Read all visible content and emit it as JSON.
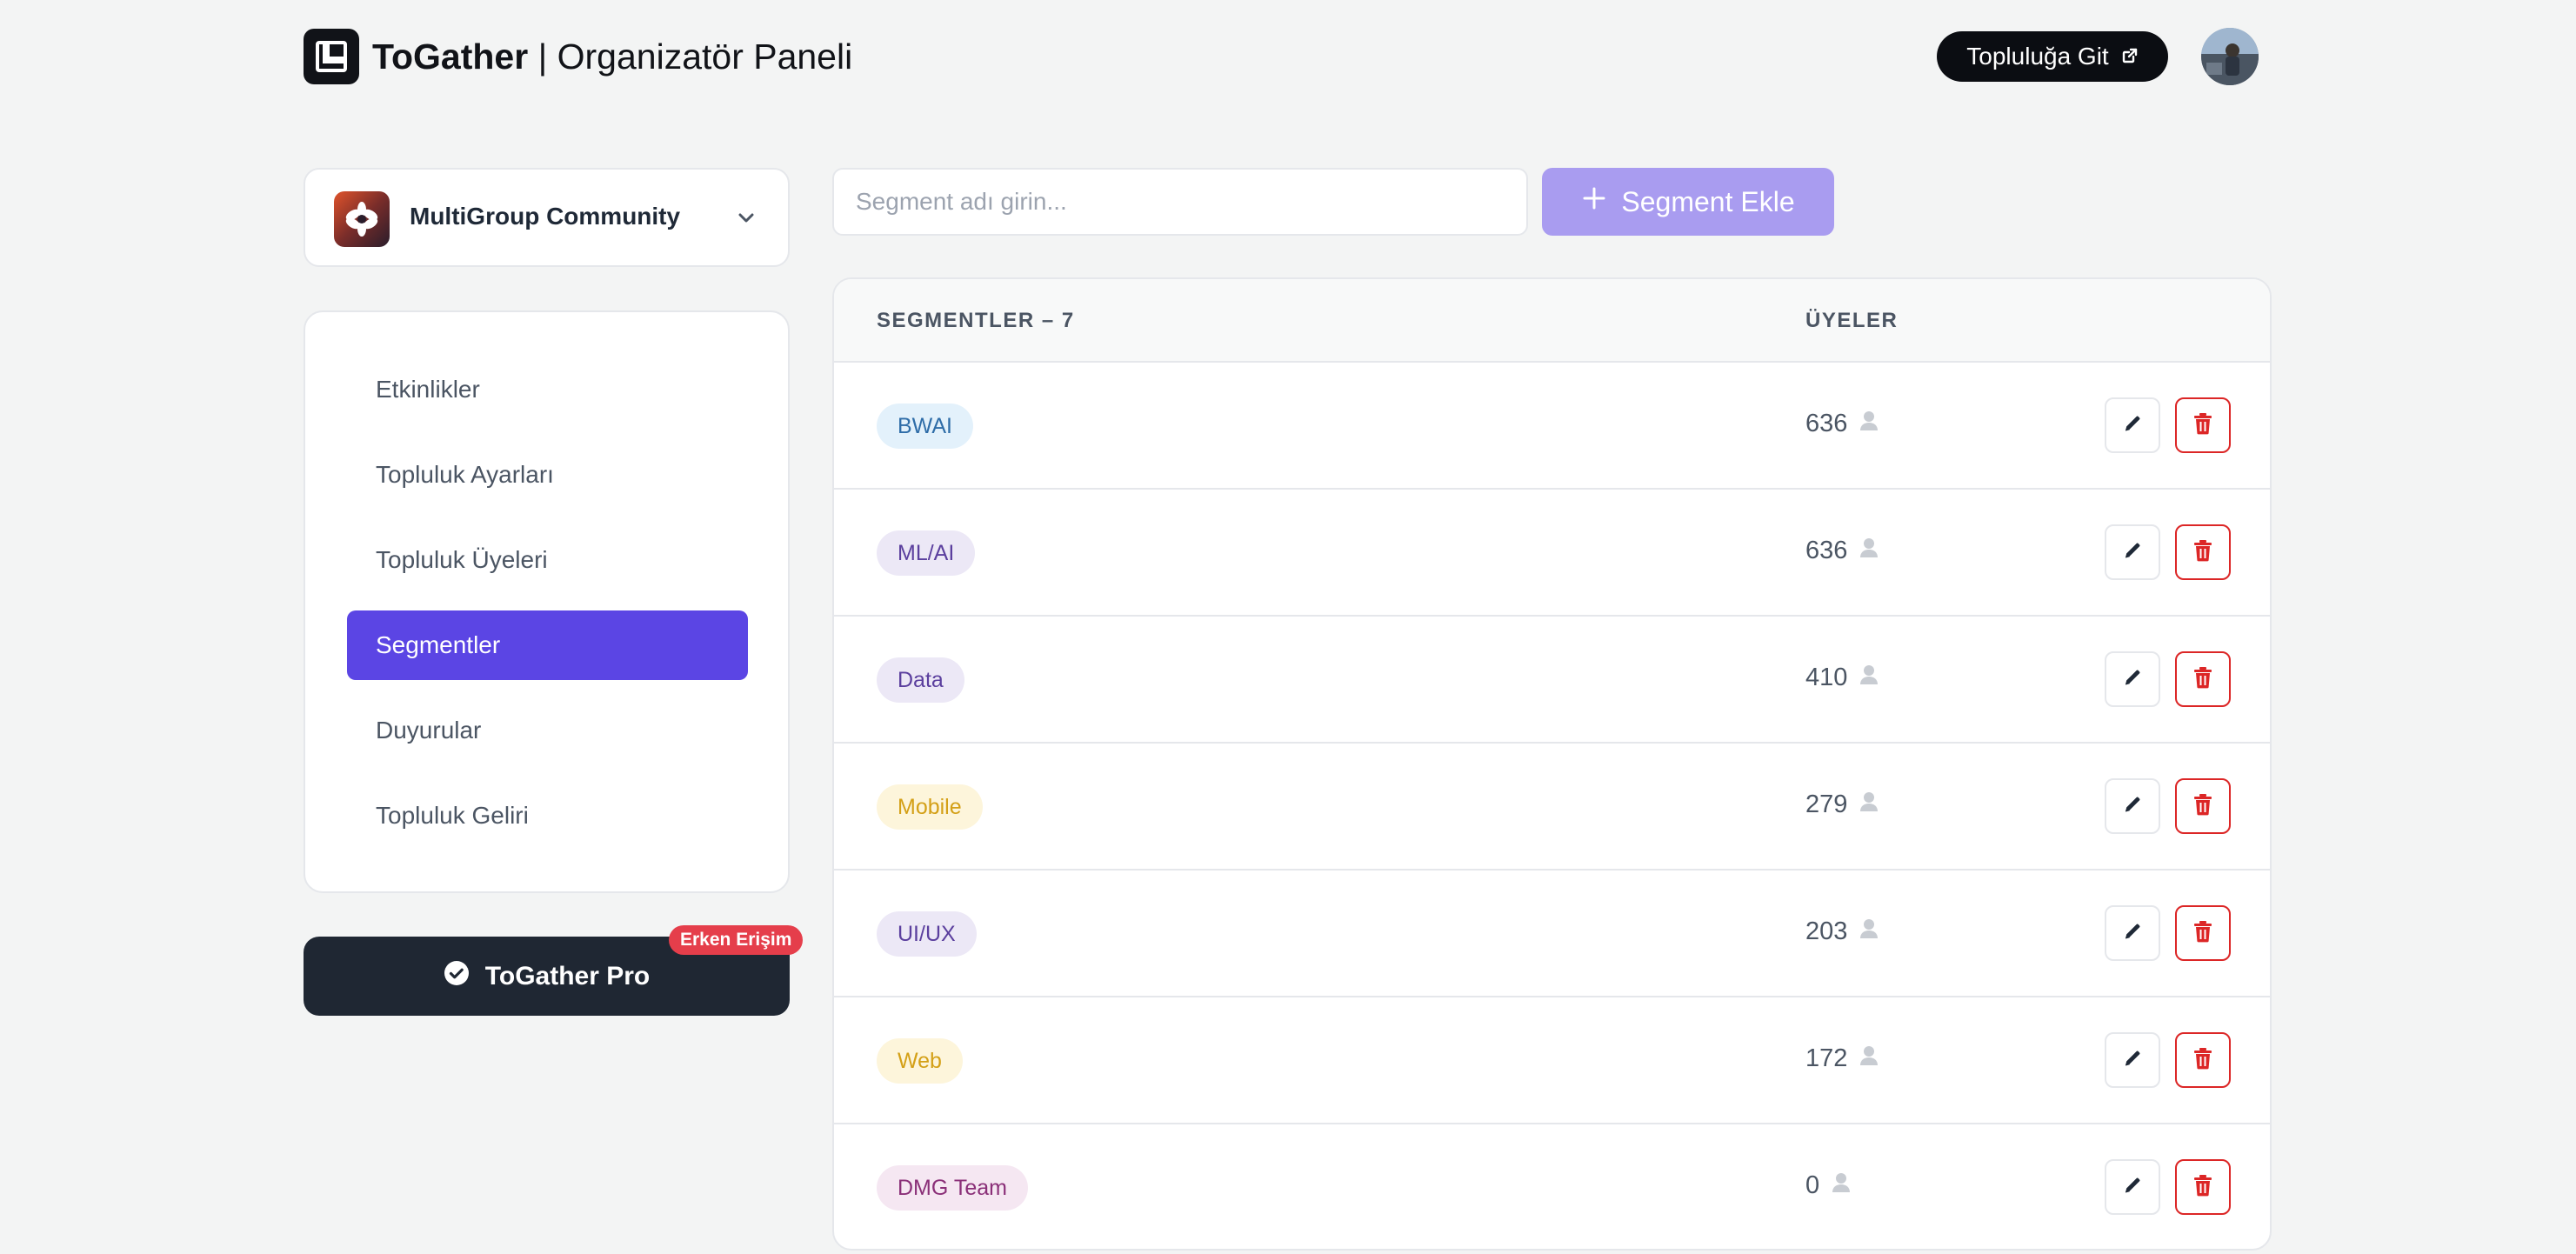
{
  "header": {
    "brand_bold": "ToGather",
    "brand_rest": " | Organizatör Paneli",
    "goto_label": "Topluluğa Git"
  },
  "sidebar": {
    "community_name": "MultiGroup Community",
    "items": [
      {
        "label": "Etkinlikler"
      },
      {
        "label": "Topluluk Ayarları"
      },
      {
        "label": "Topluluk Üyeleri"
      },
      {
        "label": "Segmentler"
      },
      {
        "label": "Duyurular"
      },
      {
        "label": "Topluluk Geliri"
      }
    ],
    "active_index": 3,
    "pro_label": "ToGather Pro",
    "early_access_badge": "Erken Erişim"
  },
  "toolbar": {
    "input_placeholder": "Segment adı girin...",
    "add_label": "Segment Ekle"
  },
  "table": {
    "col_segments": "SEGMENTLER – 7",
    "col_members": "ÜYELER",
    "rows": [
      {
        "name": "BWAI",
        "members": "636",
        "pill_bg": "#e3f1fb",
        "pill_fg": "#2f6da8"
      },
      {
        "name": "ML/AI",
        "members": "636",
        "pill_bg": "#ece8f6",
        "pill_fg": "#5b3f9e"
      },
      {
        "name": "Data",
        "members": "410",
        "pill_bg": "#ece8f6",
        "pill_fg": "#5b3f9e"
      },
      {
        "name": "Mobile",
        "members": "279",
        "pill_bg": "#fdf5db",
        "pill_fg": "#d4a017"
      },
      {
        "name": "UI/UX",
        "members": "203",
        "pill_bg": "#ece8f6",
        "pill_fg": "#5b3f9e"
      },
      {
        "name": "Web",
        "members": "172",
        "pill_bg": "#fdf5db",
        "pill_fg": "#d4a017"
      },
      {
        "name": "DMG Team",
        "members": "0",
        "pill_bg": "#f5e7f2",
        "pill_fg": "#8a2f78"
      }
    ]
  },
  "colors": {
    "accent": "#5b45e4",
    "accent_light": "#a99cf0",
    "danger": "#dc2626",
    "dark_button": "#1f2733"
  },
  "icons": {
    "logo": "togather-logo-icon",
    "external": "external-link-icon",
    "chevron": "chevron-down-icon",
    "check": "check-circle-icon",
    "plus": "plus-icon",
    "user": "user-icon",
    "edit": "pencil-icon",
    "delete": "trash-icon"
  }
}
